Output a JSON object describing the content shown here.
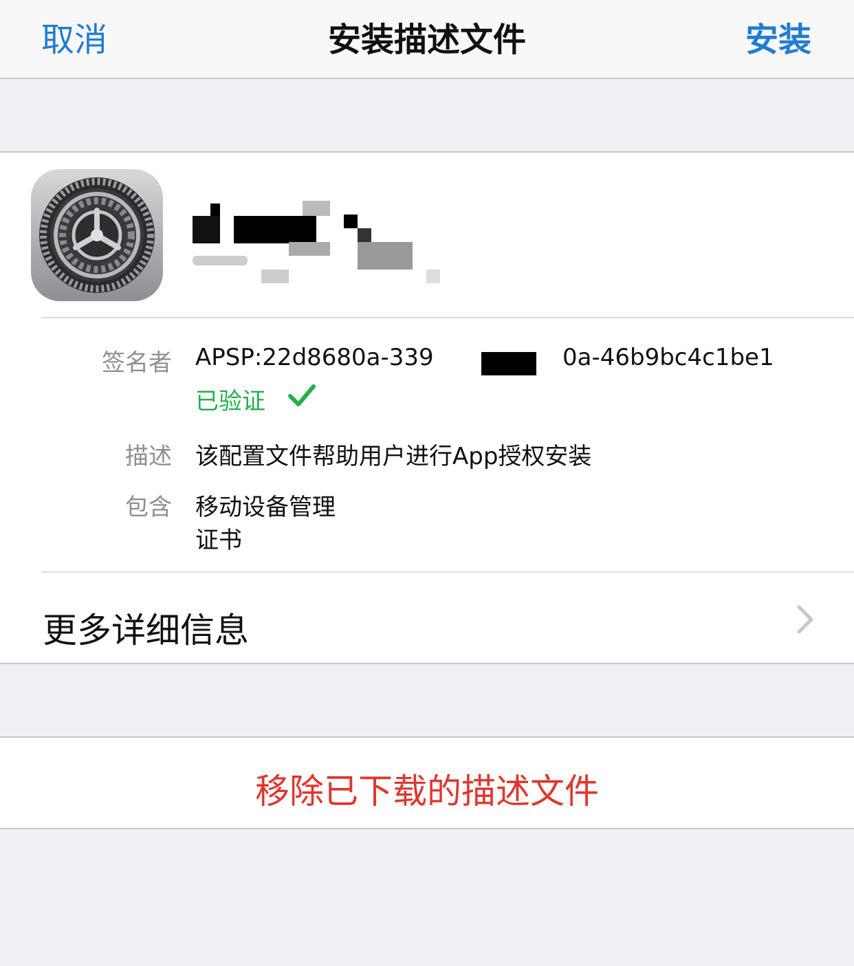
{
  "navbar": {
    "cancel_label": "取消",
    "title": "安装描述文件",
    "install_label": "安装"
  },
  "profile": {
    "icon": "settings-gear-icon",
    "name_redacted": true
  },
  "details": {
    "signer_label": "签名者",
    "signer_value_start": "APSP:22d8680a-339",
    "signer_value_end": "0a-46b9bc4c1be1",
    "verified_label": "已验证",
    "description_label": "描述",
    "description_value": "该配置文件帮助用户进行App授权安装",
    "contains_label": "包含",
    "contains_values": [
      "移动设备管理",
      "证书"
    ]
  },
  "more_info": {
    "label": "更多详细信息"
  },
  "actions": {
    "remove_label": "移除已下载的描述文件"
  },
  "colors": {
    "accent": "#1f7cd3",
    "verified": "#22b04c",
    "destructive": "#e0362d",
    "background": "#efeff4"
  }
}
